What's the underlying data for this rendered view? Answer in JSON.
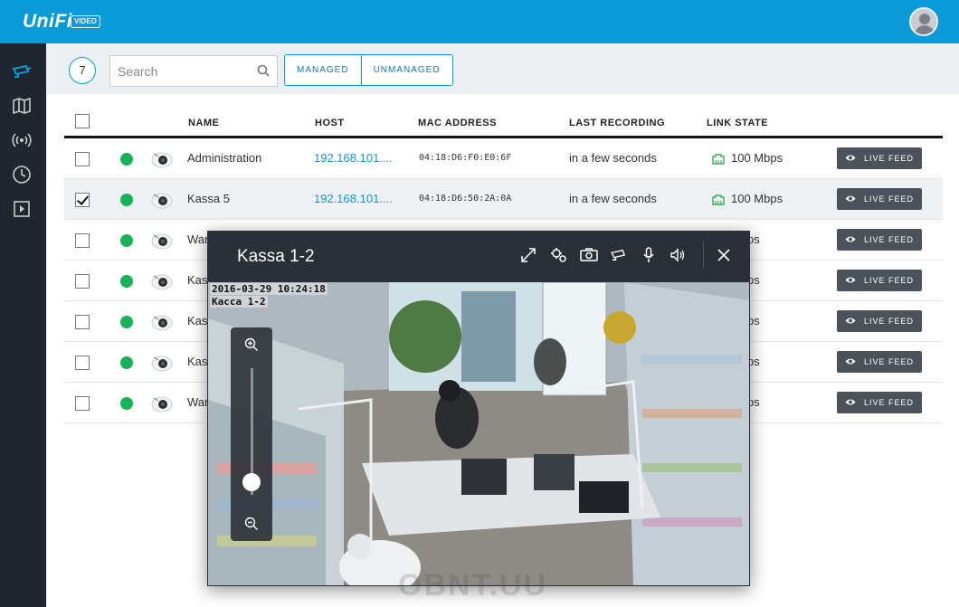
{
  "header": {
    "logo_text": "UniFi",
    "logo_badge": "VIDEO"
  },
  "sidebar": {
    "items": [
      {
        "icon": "camera-icon",
        "active": true
      },
      {
        "icon": "map-icon"
      },
      {
        "icon": "wireless-icon"
      },
      {
        "icon": "clock-icon"
      },
      {
        "icon": "play-icon"
      }
    ]
  },
  "toolbar": {
    "camera_count": "7",
    "search_placeholder": "Search",
    "managed_label": "MANAGED",
    "unmanaged_label": "UNMANAGED"
  },
  "table": {
    "columns": {
      "name": "NAME",
      "host": "HOST",
      "mac": "MAC ADDRESS",
      "last_recording": "LAST RECORDING",
      "link_state": "LINK STATE"
    },
    "live_feed_label": "LIVE FEED",
    "rows": [
      {
        "name": "Administration",
        "host": "192.168.101....",
        "mac": "04:18:D6:F0:E0:6F",
        "last_recording": "in a few seconds",
        "link": "100 Mbps",
        "checked": false
      },
      {
        "name": "Kassa 5",
        "host": "192.168.101....",
        "mac": "04:18:D6:50:2A:0A",
        "last_recording": "in a few seconds",
        "link": "100 Mbps",
        "checked": true
      },
      {
        "name": "War",
        "host": "",
        "mac": "",
        "last_recording": "",
        "link": "Mbps",
        "checked": false
      },
      {
        "name": "Kas",
        "host": "",
        "mac": "",
        "last_recording": "",
        "link": "Mbps",
        "checked": false
      },
      {
        "name": "Kas",
        "host": "",
        "mac": "",
        "last_recording": "",
        "link": "Mbps",
        "checked": false
      },
      {
        "name": "Kas",
        "host": "",
        "mac": "",
        "last_recording": "",
        "link": "Mbps",
        "checked": false
      },
      {
        "name": "War",
        "host": "",
        "mac": "",
        "last_recording": "",
        "link": "Mbps",
        "checked": false
      }
    ]
  },
  "modal": {
    "title": "Kassa 1-2",
    "osd_timestamp": "2016-03-29 10:24:18",
    "osd_camera_name": "Касса 1-2",
    "zoom_level": 0.1
  },
  "watermark": "OBNT.UU",
  "colors": {
    "brand": "#0b9ad8",
    "online": "#18b359",
    "link": "#35b05a"
  }
}
